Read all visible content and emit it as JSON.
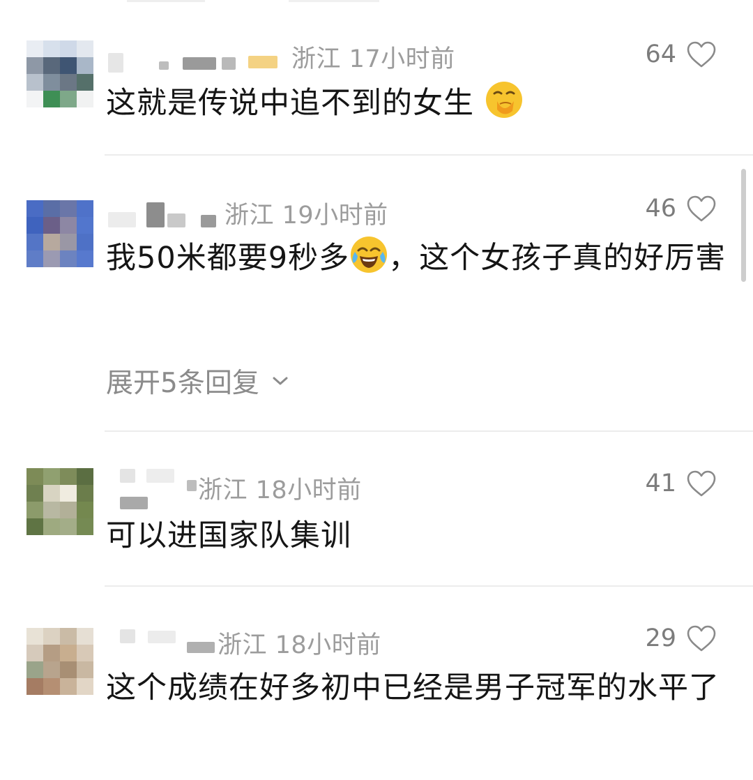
{
  "comments": [
    {
      "location_time": "浙江 17小时前",
      "likes": "64",
      "text": "这就是传说中追不到的女生",
      "emoji": "thinking-hand-over-mouth-emoji"
    },
    {
      "location_time": "浙江 19小时前",
      "likes": "46",
      "text": "我50米都要9秒多",
      "text_after_emoji": "，这个女孩子真的好厉害",
      "emoji": "crying-laughing-emoji",
      "replies_label": "展开5条回复"
    },
    {
      "location_time": "浙江 18小时前",
      "likes": "41",
      "text": "可以进国家队集训"
    },
    {
      "location_time": "浙江 18小时前",
      "likes": "29",
      "text": "这个成绩在好多初中已经是男子冠军的水平了"
    }
  ],
  "icons": {
    "like": "heart-outline-icon",
    "expand": "chevron-down-icon"
  },
  "colors": {
    "text": "#151515",
    "meta": "#9c9c9c",
    "like_count": "#7c7c7c",
    "divider": "#ececec",
    "emoji_yellow": "#f7c42e"
  }
}
